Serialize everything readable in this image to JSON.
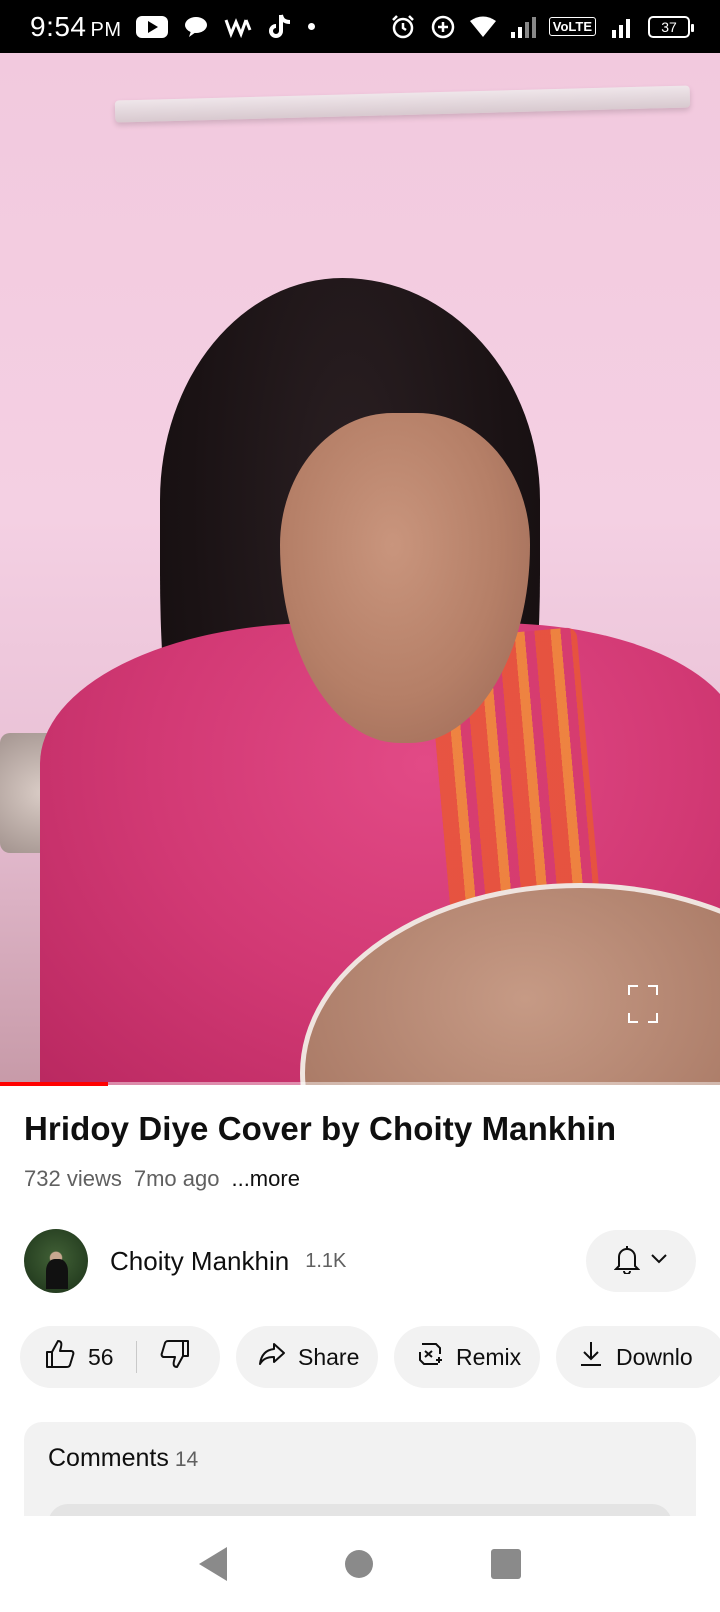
{
  "status_bar": {
    "time": "9:54",
    "ampm": "PM",
    "left_icons": [
      "youtube-icon",
      "chat-bubble-icon",
      "app-notification-icon",
      "tiktok-icon",
      "more-notifications-dot"
    ],
    "right_icons": [
      "alarm-icon",
      "data-saver-icon",
      "wifi-icon",
      "signal-icon"
    ],
    "volte": "VoLTE",
    "battery": "37"
  },
  "video": {
    "progress_fraction": 0.15,
    "fullscreen_icon": "fullscreen-icon"
  },
  "details": {
    "title": "Hridoy Diye Cover by Choity Mankhin",
    "views": "732 views",
    "age": "7mo ago",
    "more_label": "...more"
  },
  "channel": {
    "name": "Choity Mankhin",
    "subscribers": "1.1K",
    "bell_icon": "bell-icon",
    "chevron_icon": "chevron-down-icon"
  },
  "actions": {
    "like_count": "56",
    "share_label": "Share",
    "remix_label": "Remix",
    "download_label": "Downlo"
  },
  "comments": {
    "title": "Comments",
    "count": "14"
  },
  "nav": [
    "back-icon",
    "home-icon",
    "recents-icon"
  ]
}
